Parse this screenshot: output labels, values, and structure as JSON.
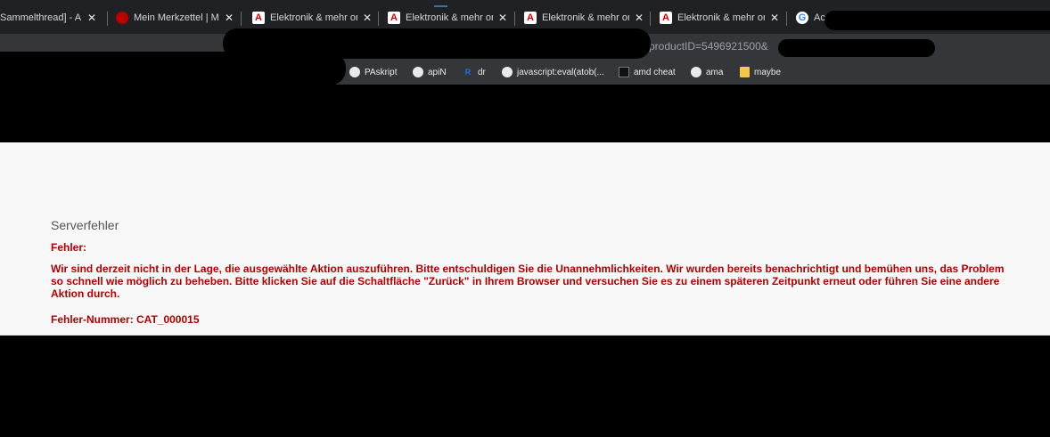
{
  "browser": {
    "tabs": [
      {
        "title": "Sammelthread] - AM",
        "icon": "forum-icon"
      },
      {
        "title": "Mein Merkzettel | Me",
        "icon": "red-circle-icon"
      },
      {
        "title": "Elektronik & mehr on",
        "icon": "amazon-icon"
      },
      {
        "title": "Elektronik & mehr on",
        "icon": "amazon-icon"
      },
      {
        "title": "Elektronik & mehr on",
        "icon": "amazon-icon"
      },
      {
        "title": "Elektronik & mehr on",
        "icon": "amazon-icon"
      },
      {
        "title": "Ac",
        "icon": "google-icon"
      }
    ],
    "tab_close": "✕",
    "amazon_glyph": "A",
    "google_glyph": "G",
    "url_visible": "productID=5496921500&",
    "bookmarks": [
      {
        "label": "PAskript",
        "icon": "globe-icon"
      },
      {
        "label": "apiN",
        "icon": "globe-icon"
      },
      {
        "label": "dr",
        "icon": "r-icon"
      },
      {
        "label": "javascript:eval(atob(...",
        "icon": "globe-icon"
      },
      {
        "label": "amd cheat",
        "icon": "amd-icon"
      },
      {
        "label": "ama",
        "icon": "globe-icon"
      },
      {
        "label": "maybe",
        "icon": "folder-icon"
      }
    ]
  },
  "page": {
    "heading": "Serverfehler",
    "error_label": "Fehler:",
    "error_message": "Wir sind derzeit nicht in der Lage, die ausgewählte Aktion auszuführen. Bitte entschuldigen Sie die Unannehmlichkeiten. Wir wurden bereits benachrichtigt und bemühen uns, das Problem so schnell wie möglich zu beheben. Bitte klicken Sie auf die Schaltfläche \"Zurück\" in Ihrem Browser und versuchen Sie es zu einem späteren Zeitpunkt erneut oder führen Sie eine andere Aktion durch.",
    "error_number": "Fehler-Nummer:  CAT_000015"
  },
  "colors": {
    "error_red": "#b30000",
    "chrome_dark": "#202124",
    "chrome_toolbar": "#35363a"
  }
}
